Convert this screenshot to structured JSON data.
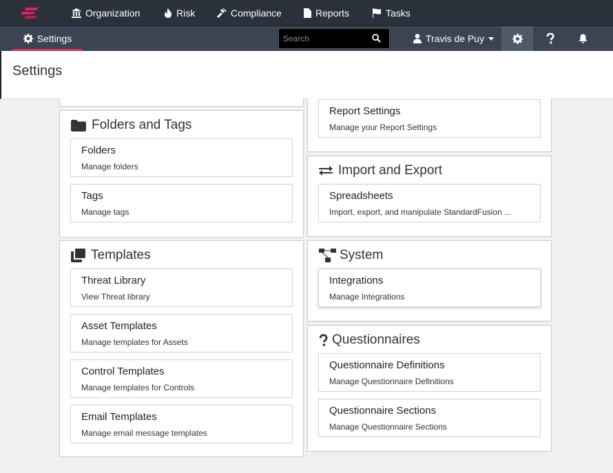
{
  "nav": {
    "items": [
      {
        "label": "Organization",
        "icon": "bank-icon"
      },
      {
        "label": "Risk",
        "icon": "flame-icon"
      },
      {
        "label": "Compliance",
        "icon": "gavel-icon"
      },
      {
        "label": "Reports",
        "icon": "file-icon"
      },
      {
        "label": "Tasks",
        "icon": "flag-icon"
      }
    ]
  },
  "subbar": {
    "settings_tab": "Settings",
    "search_placeholder": "Search",
    "user_name": "Travis de Puy",
    "accent": "#e0245e"
  },
  "page": {
    "title": "Settings"
  },
  "panels": {
    "folders_tags": {
      "title": "Folders and Tags",
      "cards": [
        {
          "title": "Folders",
          "desc": "Manage folders"
        },
        {
          "title": "Tags",
          "desc": "Manage tags"
        }
      ]
    },
    "templates": {
      "title": "Templates",
      "cards": [
        {
          "title": "Threat Library",
          "desc": "View Threat library"
        },
        {
          "title": "Asset Templates",
          "desc": "Manage templates for Assets"
        },
        {
          "title": "Control Templates",
          "desc": "Manage templates for Controls"
        },
        {
          "title": "Email Templates",
          "desc": "Manage email message templates"
        }
      ]
    },
    "report": {
      "cards": [
        {
          "title": "Report Settings",
          "desc": "Manage your Report Settings"
        }
      ]
    },
    "import_export": {
      "title": "Import and Export",
      "cards": [
        {
          "title": "Spreadsheets",
          "desc": "Import, export, and manipulate StandardFusion ..."
        }
      ]
    },
    "system": {
      "title": "System",
      "cards": [
        {
          "title": "Integrations",
          "desc": "Manage Integrations"
        }
      ]
    },
    "questionnaires": {
      "title": "Questionnaires",
      "cards": [
        {
          "title": "Questionnaire Definitions",
          "desc": "Manage Questionnaire Definitions"
        },
        {
          "title": "Questionnaire Sections",
          "desc": "Manage Questionnaire Sections"
        }
      ]
    }
  }
}
